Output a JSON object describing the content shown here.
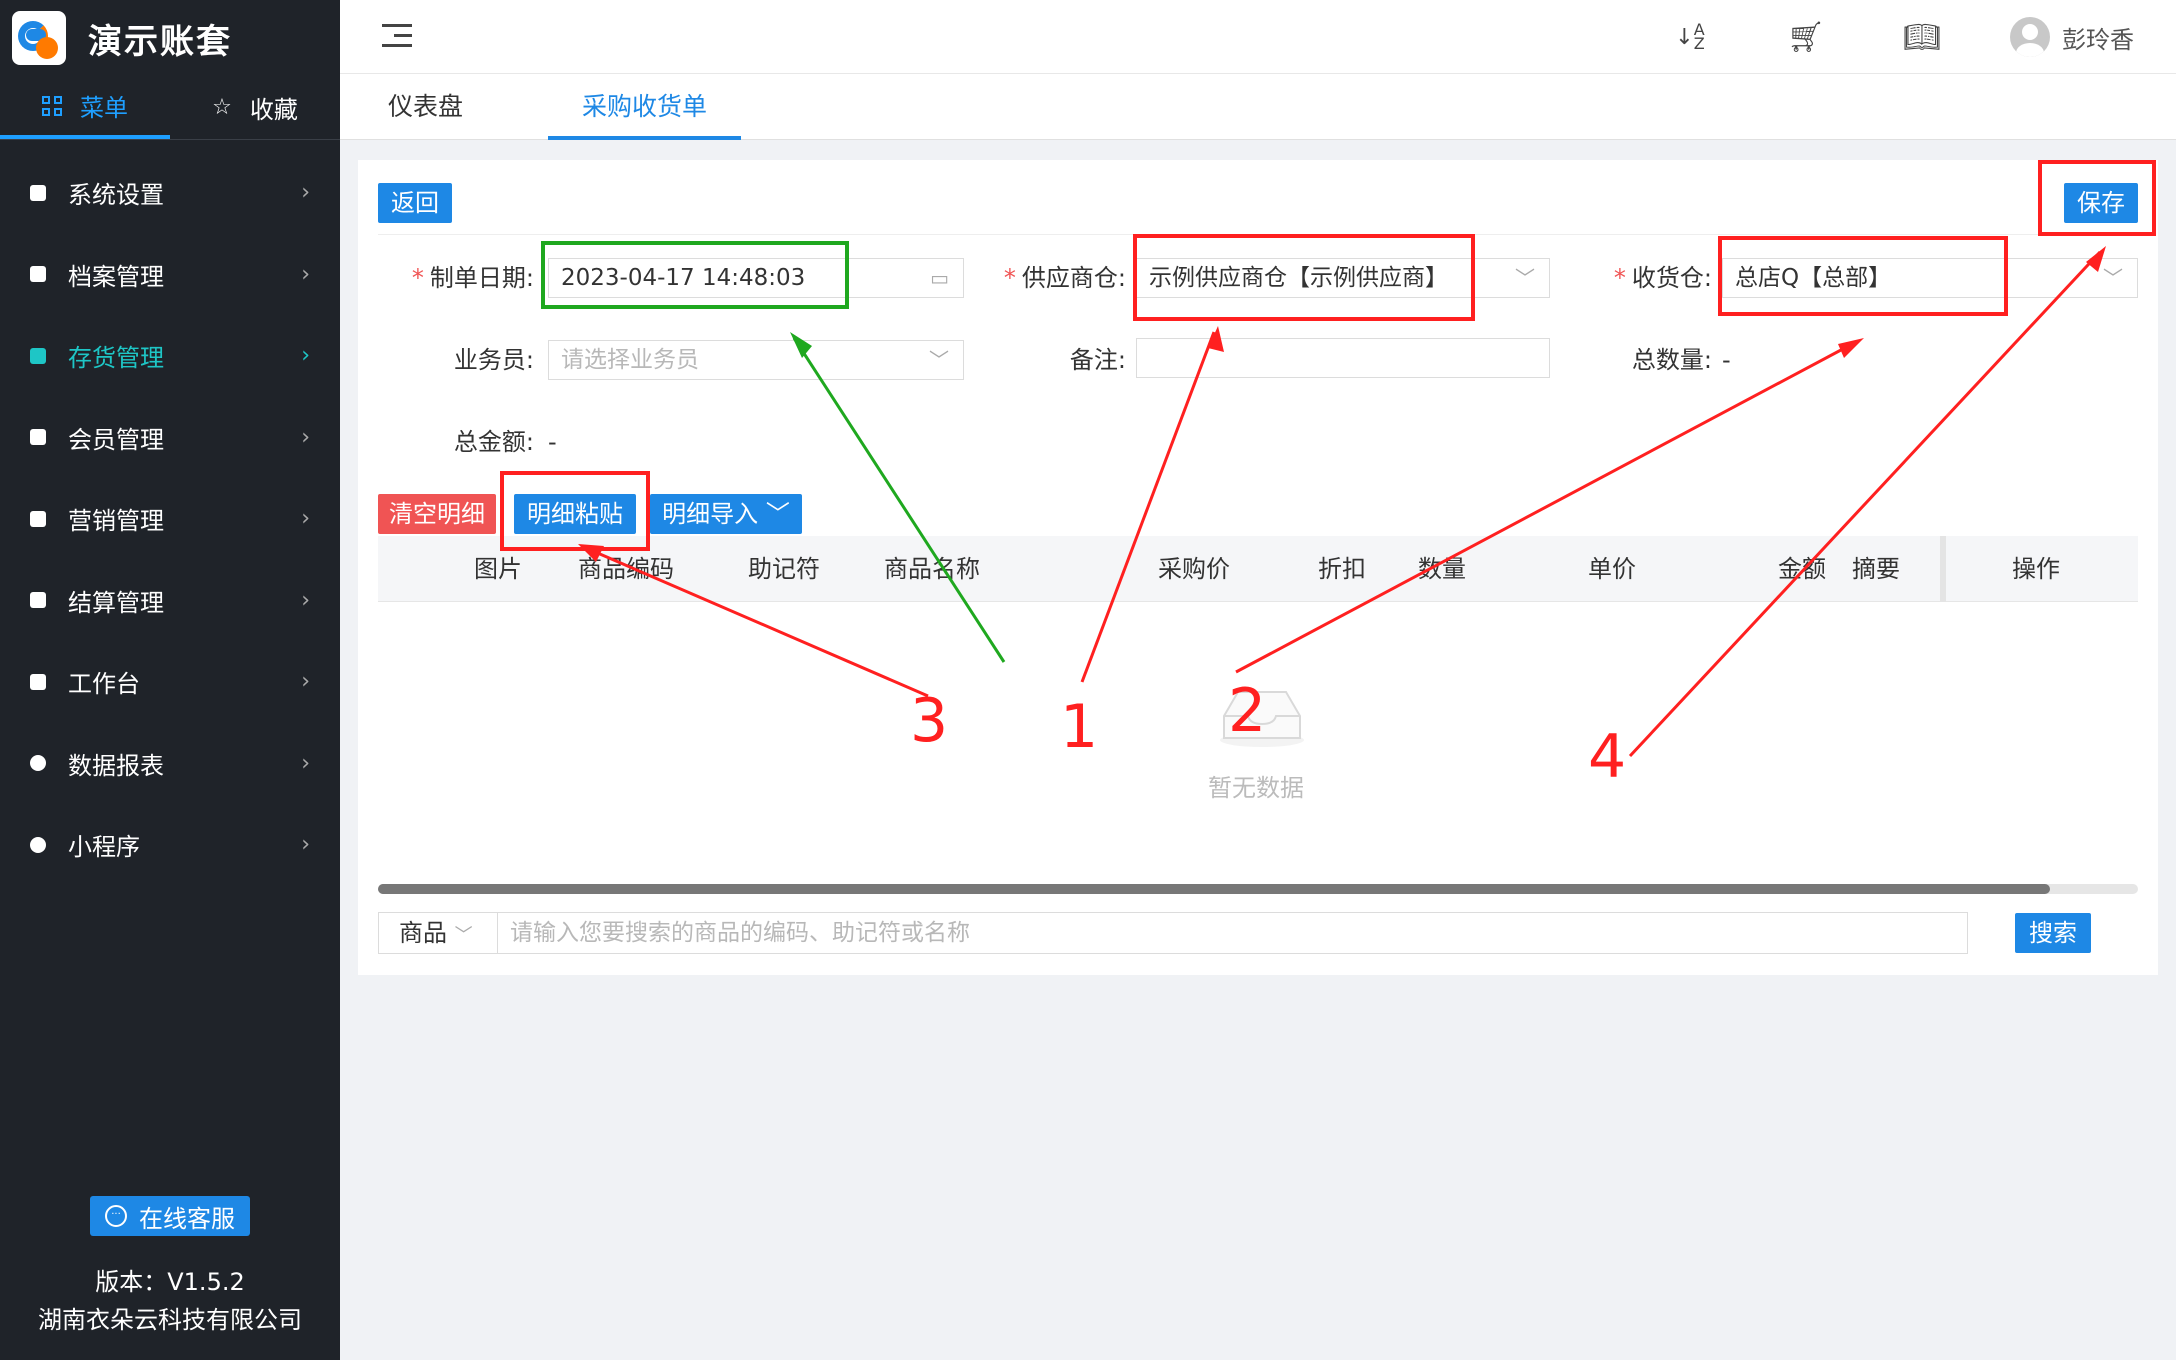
{
  "sidebar": {
    "brand": "演示账套",
    "tabs": [
      {
        "label": "菜单",
        "active": true
      },
      {
        "label": "收藏",
        "active": false
      }
    ],
    "items": [
      {
        "label": "系统设置",
        "active": false
      },
      {
        "label": "档案管理",
        "active": false
      },
      {
        "label": "存货管理",
        "active": true
      },
      {
        "label": "会员管理",
        "active": false
      },
      {
        "label": "营销管理",
        "active": false
      },
      {
        "label": "结算管理",
        "active": false
      },
      {
        "label": "工作台",
        "active": false
      },
      {
        "label": "数据报表",
        "active": false
      },
      {
        "label": "小程序",
        "active": false
      }
    ],
    "support": "在线客服",
    "version": "版本：V1.5.2",
    "company": "湖南衣朵云科技有限公司"
  },
  "topbar": {
    "icons": [
      "sort-az-icon",
      "cart-icon",
      "book-icon"
    ],
    "user": "彭玲香"
  },
  "pagetabs": [
    {
      "label": "仪表盘",
      "active": false
    },
    {
      "label": "采购收货单",
      "active": true
    }
  ],
  "form": {
    "back": "返回",
    "save": "保存",
    "date_label": "制单日期:",
    "date_value": "2023-04-17 14:48:03",
    "supplier_label": "供应商仓:",
    "supplier_value": "示例供应商仓【示例供应商】",
    "warehouse_label": "收货仓:",
    "warehouse_value": "总店Q【总部】",
    "salesman_label": "业务员:",
    "salesman_placeholder": "请选择业务员",
    "remark_label": "备注:",
    "total_qty_label": "总数量:",
    "total_qty_value": "-",
    "total_amount_label": "总金额:",
    "total_amount_value": "-"
  },
  "toolbar": {
    "clear": "清空明细",
    "paste": "明细粘贴",
    "import": "明细导入"
  },
  "table": {
    "columns": [
      "图片",
      "商品编码",
      "助记符",
      "商品名称",
      "采购价",
      "折扣",
      "数量",
      "单价",
      "金额",
      "摘要",
      "操作"
    ],
    "empty": "暂无数据"
  },
  "search": {
    "type": "商品",
    "placeholder": "请输入您要搜索的商品的编码、助记符或名称",
    "button": "搜索"
  },
  "annotations": [
    "1",
    "2",
    "3",
    "4"
  ],
  "colors": {
    "accent": "#1e88e5",
    "danger": "#f05454",
    "annotation_red": "#ff2020",
    "annotation_green": "#1fa81f"
  }
}
